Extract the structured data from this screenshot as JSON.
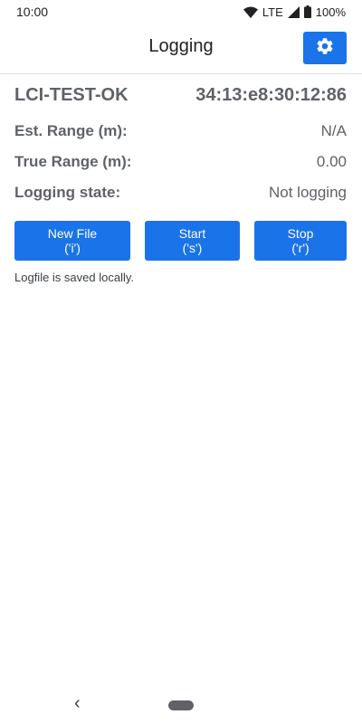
{
  "status_bar": {
    "time": "10:00",
    "network": "LTE",
    "battery": "100%",
    "icons": [
      "wifi-icon",
      "cell-signal-icon",
      "battery-icon"
    ]
  },
  "app_bar": {
    "title": "Logging",
    "settings_icon": "gear-icon"
  },
  "device": {
    "name": "LCI-TEST-OK",
    "mac": "34:13:e8:30:12:86"
  },
  "info_rows": [
    {
      "label": "Est. Range (m):",
      "value": "N/A"
    },
    {
      "label": "True Range (m):",
      "value": "0.00"
    },
    {
      "label": "Logging state:",
      "value": "Not logging"
    }
  ],
  "buttons": [
    {
      "line1": "New File",
      "line2": "('i')"
    },
    {
      "line1": "Start",
      "line2": "('s')"
    },
    {
      "line1": "Stop",
      "line2": "('r')"
    }
  ],
  "note": "Logfile is saved locally.",
  "nav_bar": {
    "back": "‹",
    "icons": [
      "back-icon",
      "home-pill-icon"
    ]
  },
  "colors": {
    "accent": "#1a73e8",
    "text_secondary": "#5f6368"
  }
}
